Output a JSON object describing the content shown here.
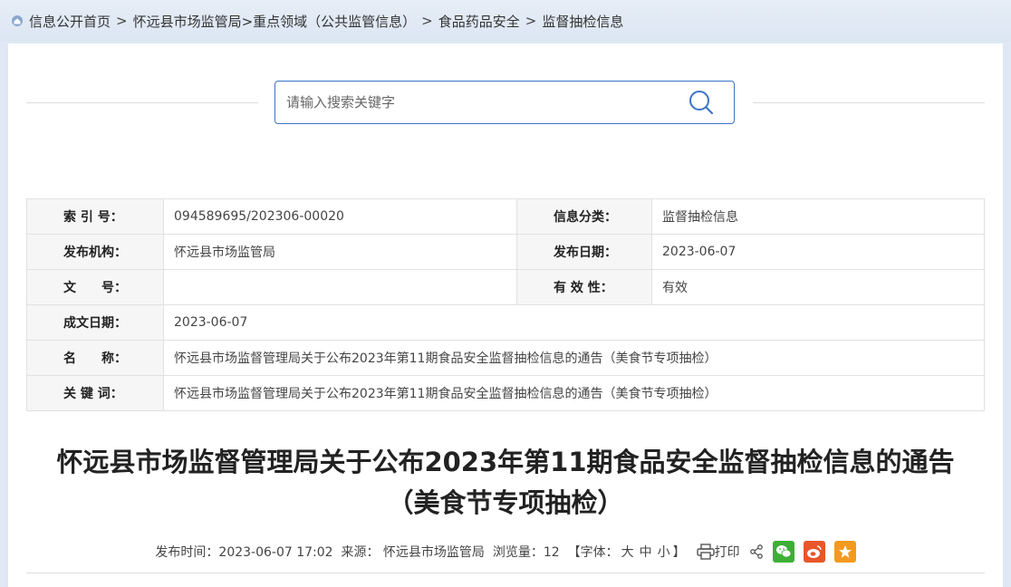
{
  "breadcrumb": {
    "items": [
      "信息公开首页",
      "怀远县市场监管局>重点领域（公共监管信息）",
      "食品药品安全",
      "监督抽检信息"
    ],
    "separator": ">"
  },
  "search": {
    "placeholder": "请输入搜索关键字"
  },
  "meta": {
    "index_label": "索 引 号：",
    "index_value": "094589695/202306-00020",
    "category_label": "信息分类：",
    "category_value": "监督抽检信息",
    "publisher_label": "发布机构：",
    "publisher_value": "怀远县市场监管局",
    "pubdate_label": "发布日期：",
    "pubdate_value": "2023-06-07",
    "docno_label": "文　　号：",
    "docno_value": "",
    "validity_label": "有 效 性：",
    "validity_value": "有效",
    "created_label": "成文日期：",
    "created_value": "2023-06-07",
    "name_label": "名　　称：",
    "name_value": "怀远县市场监督管理局关于公布2023年第11期食品安全监督抽检信息的通告（美食节专项抽检）",
    "keywords_label": "关 键 词：",
    "keywords_value": "怀远县市场监督管理局关于公布2023年第11期食品安全监督抽检信息的通告（美食节专项抽检）"
  },
  "article": {
    "title_line1": "怀远县市场监督管理局关于公布2023年第11期食品安全监督抽检信息的通告",
    "title_line2": "（美食节专项抽检）"
  },
  "info_bar": {
    "time": "发布时间：2023-06-07 17:02",
    "source": "来源： 怀远县市场监管局",
    "views": "浏览量：12",
    "font_prefix": "【字体：",
    "font_large": "大",
    "font_medium": "中",
    "font_small": "小",
    "font_suffix": "】",
    "print": "打印"
  },
  "colors": {
    "accent": "#3a75c4",
    "wechat": "#3cb034",
    "weibo": "#e8562a",
    "favorite": "#f39a1e"
  },
  "icons": [
    "home-icon",
    "search-icon",
    "print-icon",
    "share-icon",
    "wechat-icon",
    "weibo-icon",
    "favorite-icon"
  ]
}
